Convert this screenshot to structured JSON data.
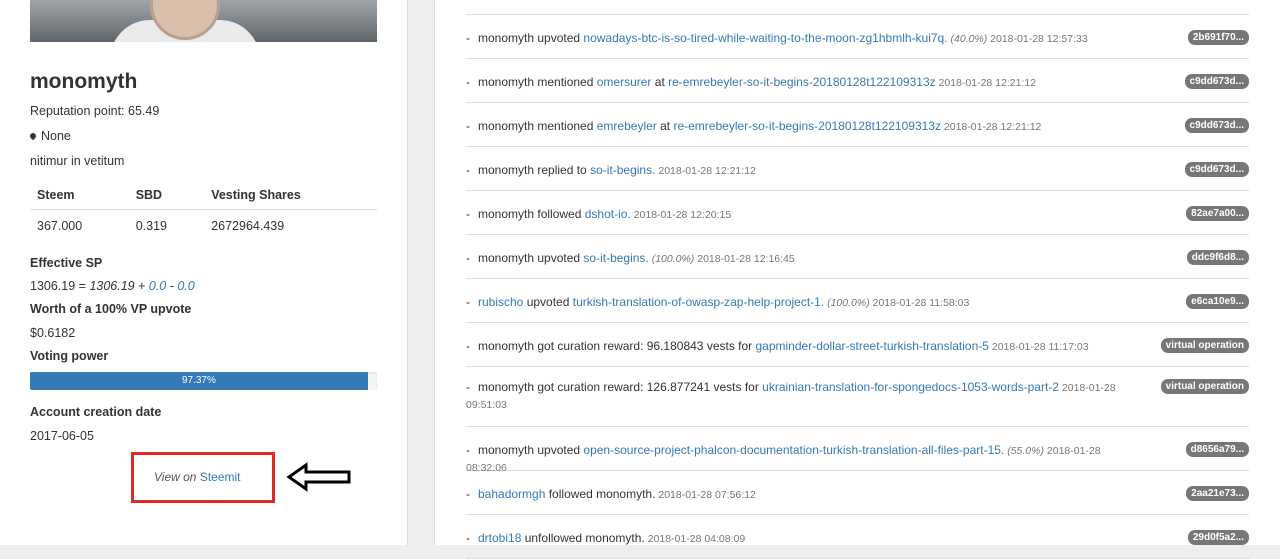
{
  "profile": {
    "username": "monomyth",
    "reputation": "Reputation point: 65.49",
    "location": "None",
    "bio": "nitimur in vetitum"
  },
  "wallet": {
    "headers": [
      "Steem",
      "SBD",
      "Vesting Shares"
    ],
    "values": [
      "367.000",
      "0.319",
      "2672964.439"
    ]
  },
  "effective_sp": {
    "label": "Effective SP",
    "total": "1306.19",
    "eq": " = ",
    "own": "1306.19",
    "plus1": " + ",
    "delegated_in": "0.0",
    "minus": " - ",
    "delegated_out": "0.0"
  },
  "worth": {
    "label": "Worth of a 100% VP upvote",
    "value": "$0.6182"
  },
  "voting_power": {
    "label": "Voting power",
    "text": "97.37%",
    "percent": 97.37
  },
  "creation": {
    "label": "Account creation date",
    "value": "2017-06-05"
  },
  "view": {
    "prefix": "View on ",
    "link": "Steemit"
  },
  "activity": [
    {
      "kind": "1",
      "actor": "monomyth",
      "text1": " upvoted ",
      "link1": "nowadays-btc-is-so-tired-while-waiting-to-the-moon-zg1hbmlh-kui7q.",
      "text2": "",
      "link2": "",
      "meta": " (40.0%)",
      "date": " 2018-01-28 12:57:33",
      "badge": "2b691f70..."
    },
    {
      "kind": "1",
      "actor": "monomyth",
      "text1": " mentioned ",
      "link1": "omersurer",
      "text2": " at ",
      "link2": "re-emrebeyler-so-it-begins-20180128t122109313z",
      "meta": "",
      "date": " 2018-01-28 12:21:12",
      "badge": "c9dd673d..."
    },
    {
      "kind": "1",
      "actor": "monomyth",
      "text1": " mentioned ",
      "link1": "emrebeyler",
      "text2": " at ",
      "link2": "re-emrebeyler-so-it-begins-20180128t122109313z",
      "meta": "",
      "date": " 2018-01-28 12:21:12",
      "badge": "c9dd673d..."
    },
    {
      "kind": "1",
      "actor": "monomyth",
      "text1": " replied to ",
      "link1": "so-it-begins.",
      "text2": "",
      "link2": "",
      "meta": "",
      "date": " 2018-01-28 12:21:12",
      "badge": "c9dd673d..."
    },
    {
      "kind": "1",
      "actor": "monomyth",
      "text1": " followed ",
      "link1": "dshot-io.",
      "text2": "",
      "link2": "",
      "meta": "",
      "date": " 2018-01-28 12:20:15",
      "badge": "82ae7a00..."
    },
    {
      "kind": "1",
      "actor": "monomyth",
      "text1": " upvoted ",
      "link1": "so-it-begins.",
      "text2": "",
      "link2": "",
      "meta": " (100.0%)",
      "date": " 2018-01-28 12:16:45",
      "badge": "ddc9f6d8..."
    },
    {
      "kind": "2",
      "actor": "rubischo",
      "text1": " upvoted ",
      "link1": "turkish-translation-of-owasp-zap-help-project-1.",
      "text2": "",
      "link2": "",
      "meta": " (100.0%)",
      "date": " 2018-01-28 11:58:03",
      "badge": "e6ca10e9..."
    },
    {
      "kind": "1",
      "actor": "monomyth",
      "text1": " got curation reward: 96.180843 vests for ",
      "link1": "gapminder-dollar-street-turkish-translation-5",
      "text2": "",
      "link2": "",
      "meta": "",
      "date": " 2018-01-28 11:17:03",
      "badge": "virtual operation"
    },
    {
      "kind": "1",
      "actor": "monomyth",
      "text1": " got curation reward: 126.877241 vests for ",
      "link1": "ukrainian-translation-for-spongedocs-1053-words-part-2",
      "text2": "",
      "link2": "",
      "meta": "",
      "date": " 2018-01-28 09:51:03",
      "badge": "virtual operation",
      "tall": true
    },
    {
      "kind": "1",
      "actor": "monomyth",
      "text1": " upvoted ",
      "link1": "open-source-project-phalcon-documentation-turkish-translation-all-files-part-15.",
      "text2": "",
      "link2": "",
      "meta": " (55.0%)",
      "date": " 2018-01-28 08:32:06",
      "badge": "d8656a79..."
    },
    {
      "kind": "2",
      "actor": "bahadormgh",
      "text1": " followed monomyth.",
      "link1": "",
      "text2": "",
      "link2": "",
      "meta": "",
      "date": " 2018-01-28 07:56:12",
      "badge": "2aa21e73..."
    },
    {
      "kind": "2",
      "actor": "drtobi18",
      "text1": " unfollowed monomyth.",
      "link1": "",
      "text2": "",
      "link2": "",
      "meta": "",
      "date": " 2018-01-28 04:08:09",
      "badge": "29d0f5a2..."
    }
  ],
  "colors": {
    "link": "#337ab7",
    "bar": "#337ab7",
    "badge": "#777777",
    "annotation": "#e02828"
  },
  "icons": {
    "location": "map-marker-icon",
    "annotation": "hollow-arrow-left-icon"
  }
}
